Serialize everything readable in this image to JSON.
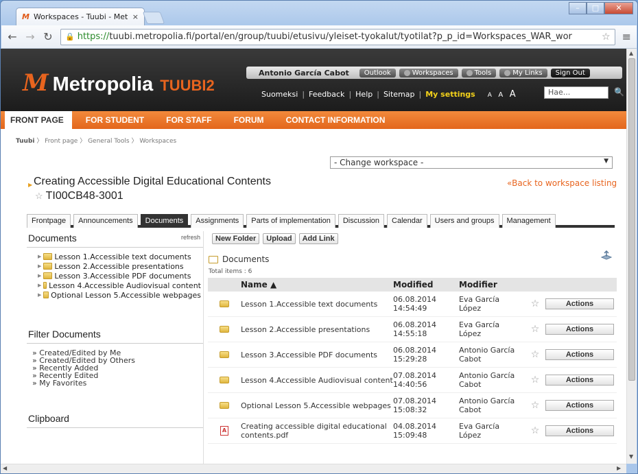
{
  "browser": {
    "tab_title": "Workspaces - Tuubi - Met",
    "tab_close": "×",
    "url_https": "https://",
    "url_rest": "tuubi.metropolia.fi/portal/en/group/tuubi/etusivu/yleiset-tyokalut/tyotilat?p_p_id=Workspaces_WAR_wor"
  },
  "header": {
    "logo_text": "Metropolia",
    "logo_sub": "TUUBI2",
    "user_name": "Antonio García Cabot",
    "top_buttons": [
      "Outlook",
      "Workspaces",
      "Tools",
      "My Links",
      "Sign Out"
    ],
    "links": [
      "Suomeksi",
      "Feedback",
      "Help",
      "Sitemap"
    ],
    "my_settings": "My settings",
    "search_placeholder": "Hae..."
  },
  "nav": [
    "FRONT PAGE",
    "FOR STUDENT",
    "FOR STAFF",
    "FORUM",
    "CONTACT INFORMATION"
  ],
  "breadcrumb": [
    "Tuubi",
    "Front page",
    "General Tools",
    "Workspaces"
  ],
  "change_workspace": "- Change workspace -",
  "workspace": {
    "title": "Creating Accessible Digital Educational Contents",
    "code": "TI00CB48-3001",
    "back_link": "«Back to workspace listing"
  },
  "tabs": [
    "Frontpage",
    "Announcements",
    "Documents",
    "Assignments",
    "Parts of implementation",
    "Discussion",
    "Calendar",
    "Users and groups",
    "Management"
  ],
  "left": {
    "documents_heading": "Documents",
    "refresh": "refresh",
    "tree": [
      "Lesson 1.Accessible text documents",
      "Lesson 2.Accessible presentations",
      "Lesson 3.Accessible PDF documents",
      "Lesson 4.Accessible Audiovisual content",
      "Optional Lesson 5.Accessible webpages"
    ],
    "filter_heading": "Filter Documents",
    "filters": [
      "» Created/Edited by Me",
      "» Created/Edited by Others",
      "» Recently Added",
      "» Recently Edited",
      "» My Favorites"
    ],
    "clipboard_heading": "Clipboard"
  },
  "right": {
    "buttons": [
      "New Folder",
      "Upload",
      "Add Link"
    ],
    "folder_title": "Documents",
    "total_items": "Total items : 6",
    "columns": {
      "name": "Name ▲",
      "modified": "Modified",
      "modifier": "Modifier"
    },
    "actions_label": "Actions",
    "rows": [
      {
        "type": "folder",
        "name": "Lesson 1.Accessible text documents",
        "date": "06.08.2014",
        "time": "14:54:49",
        "modifier1": "Eva García",
        "modifier2": "López"
      },
      {
        "type": "folder",
        "name": "Lesson 2.Accessible presentations",
        "date": "06.08.2014",
        "time": "14:55:18",
        "modifier1": "Eva García",
        "modifier2": "López"
      },
      {
        "type": "folder",
        "name": "Lesson 3.Accessible PDF documents",
        "date": "06.08.2014",
        "time": "15:29:28",
        "modifier1": "Antonio García",
        "modifier2": "Cabot"
      },
      {
        "type": "folder",
        "name": "Lesson 4.Accessible Audiovisual content",
        "date": "07.08.2014",
        "time": "14:40:56",
        "modifier1": "Antonio García",
        "modifier2": "Cabot"
      },
      {
        "type": "folder",
        "name": "Optional Lesson 5.Accessible webpages",
        "date": "07.08.2014",
        "time": "15:08:32",
        "modifier1": "Antonio García",
        "modifier2": "Cabot"
      },
      {
        "type": "pdf",
        "name": "Creating accessible digital educational contents.pdf",
        "date": "04.08.2014",
        "time": "15:09:48",
        "modifier1": "Eva García",
        "modifier2": "López"
      }
    ]
  },
  "colors": {
    "orange": "#e8641e",
    "dark": "#333333",
    "highlight": "#f4d21a"
  }
}
